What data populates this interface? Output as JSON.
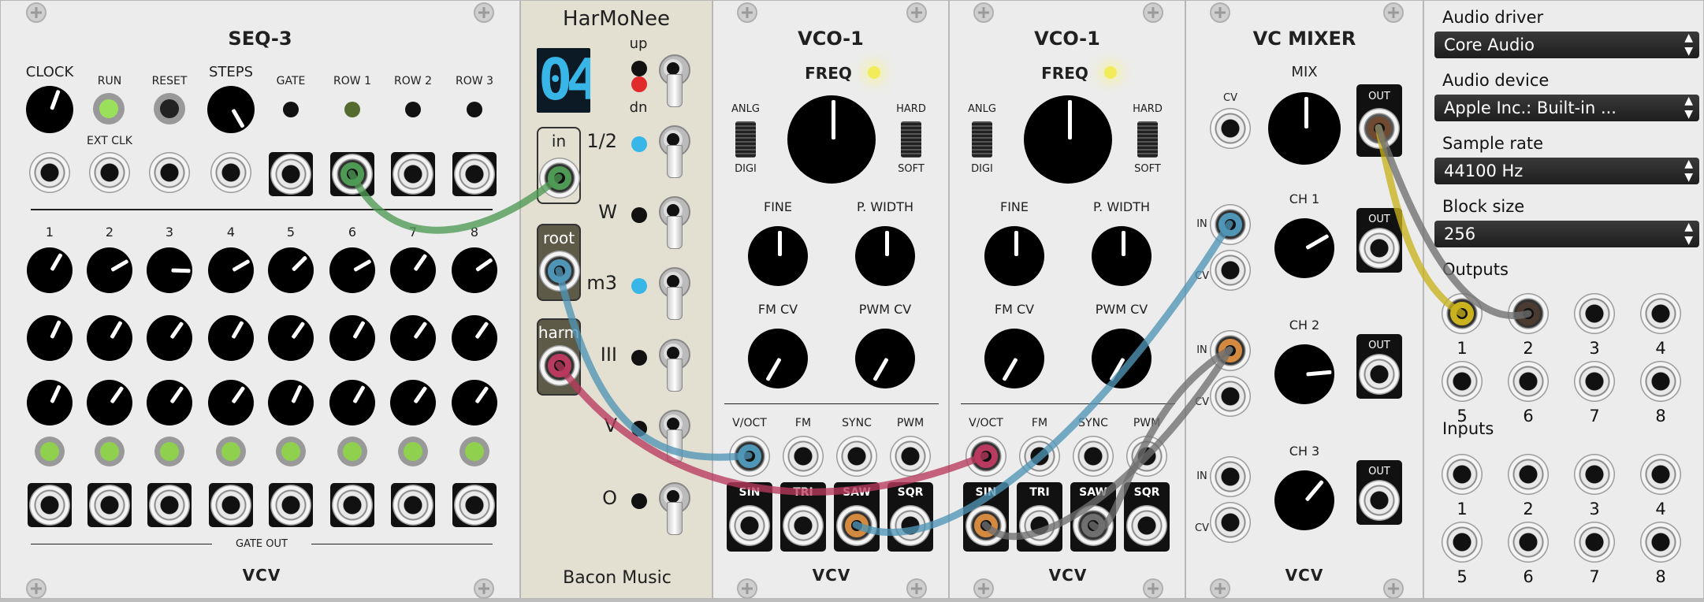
{
  "seq3": {
    "title": "SEQ-3",
    "clock": "CLOCK",
    "run": "RUN",
    "reset": "RESET",
    "steps": "STEPS",
    "ext_clk": "EXT CLK",
    "gate": "GATE",
    "row1": "ROW 1",
    "row2": "ROW 2",
    "row3": "ROW 3",
    "step_numbers": [
      "1",
      "2",
      "3",
      "4",
      "5",
      "6",
      "7",
      "8"
    ],
    "gate_out": "GATE OUT",
    "brand": "VCV"
  },
  "harmonee": {
    "title": "HarMoNee",
    "display": "04",
    "up": "up",
    "dn": "dn",
    "in": "in",
    "root": "root",
    "harm": "harm",
    "intervals": [
      "1/2",
      "W",
      "m3",
      "III",
      "V",
      "O"
    ],
    "brand": "Bacon Music"
  },
  "vco1a": {
    "title": "VCO-1",
    "freq": "FREQ",
    "anlg": "ANLG",
    "digi": "DIGI",
    "hard": "HARD",
    "soft": "SOFT",
    "fine": "FINE",
    "pwidth": "P. WIDTH",
    "fmcv": "FM CV",
    "pwmcv": "PWM CV",
    "inputs": [
      "V/OCT",
      "FM",
      "SYNC",
      "PWM"
    ],
    "outputs": [
      "SIN",
      "TRI",
      "SAW",
      "SQR"
    ],
    "brand": "VCV"
  },
  "vco1b": {
    "title": "VCO-1",
    "freq": "FREQ",
    "anlg": "ANLG",
    "digi": "DIGI",
    "hard": "HARD",
    "soft": "SOFT",
    "fine": "FINE",
    "pwidth": "P. WIDTH",
    "fmcv": "FM CV",
    "pwmcv": "PWM CV",
    "inputs": [
      "V/OCT",
      "FM",
      "SYNC",
      "PWM"
    ],
    "outputs": [
      "SIN",
      "TRI",
      "SAW",
      "SQR"
    ],
    "brand": "VCV"
  },
  "mixer": {
    "title": "VC MIXER",
    "mix": "MIX",
    "cv": "CV",
    "out": "OUT",
    "ch1": "CH 1",
    "ch2": "CH 2",
    "ch3": "CH 3",
    "in": "IN",
    "brand": "VCV"
  },
  "audio": {
    "driver_label": "Audio driver",
    "driver": "Core Audio",
    "device_label": "Audio device",
    "device": "Apple Inc.: Built-in ...",
    "rate_label": "Sample rate",
    "rate": "44100 Hz",
    "block_label": "Block size",
    "block": "256",
    "outputs_label": "Outputs",
    "inputs_label": "Inputs",
    "out_numbers": [
      "1",
      "2",
      "3",
      "4",
      "5",
      "6",
      "7",
      "8"
    ],
    "in_numbers": [
      "1",
      "2",
      "3",
      "4",
      "5",
      "6",
      "7",
      "8"
    ],
    "arrows": "▲▼"
  },
  "colors": {
    "cable_green": "#4e9a55",
    "cable_blue": "#4f95b5",
    "cable_red": "#b83a5e",
    "cable_orange": "#d3893f",
    "cable_gray": "#6f6f6f",
    "cable_yellow": "#c9b21d",
    "led_green": "#8fd14f",
    "display_blue": "#38b6e8"
  }
}
